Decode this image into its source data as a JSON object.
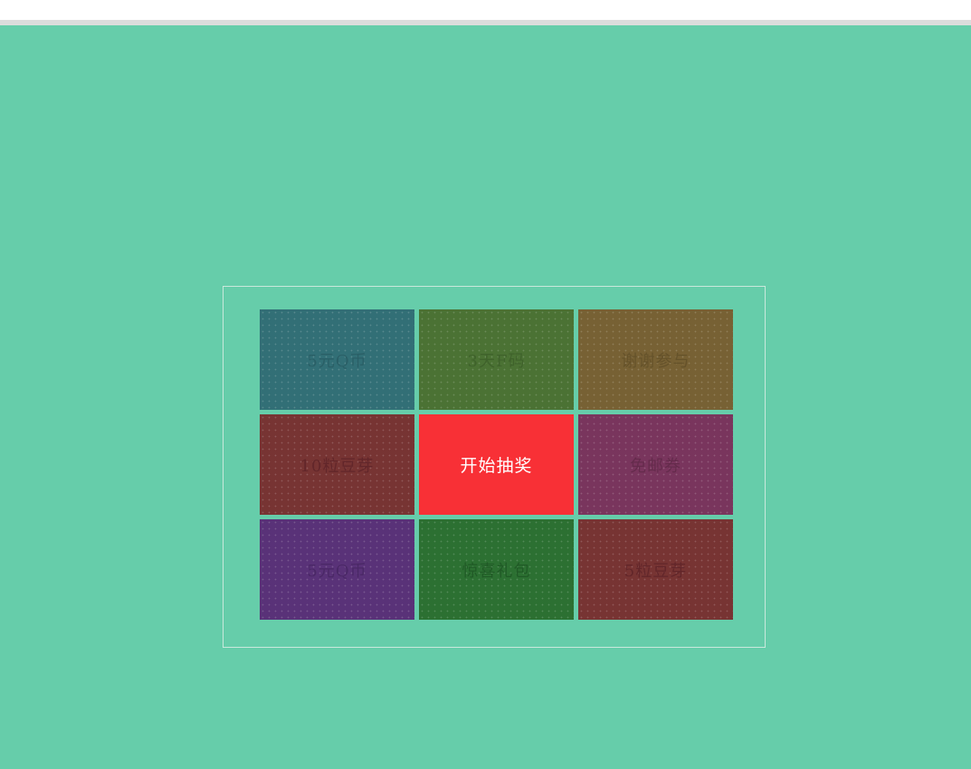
{
  "lottery": {
    "prizes": [
      {
        "label": "5元Q币",
        "bg": "#326f76",
        "fg": "#2a5f66"
      },
      {
        "label": "3天F码",
        "bg": "#4b7234",
        "fg": "#3f622b"
      },
      {
        "label": "谢谢参与",
        "bg": "#776134",
        "fg": "#65522a"
      },
      {
        "label": "10粒豆芽",
        "bg": "#773433",
        "fg": "#62262a"
      },
      {
        "label": "免邮券",
        "bg": "#79355d",
        "fg": "#652b4c"
      },
      {
        "label": "5元Q币",
        "bg": "#593278",
        "fg": "#4a2866"
      },
      {
        "label": "惊喜礼包",
        "bg": "#2c7032",
        "fg": "#205a26"
      },
      {
        "label": "5粒豆芽",
        "bg": "#773433",
        "fg": "#62262a"
      }
    ],
    "start_label": "开始抽奖",
    "start_color": "#f83036",
    "background_color": "#66cdaa"
  }
}
